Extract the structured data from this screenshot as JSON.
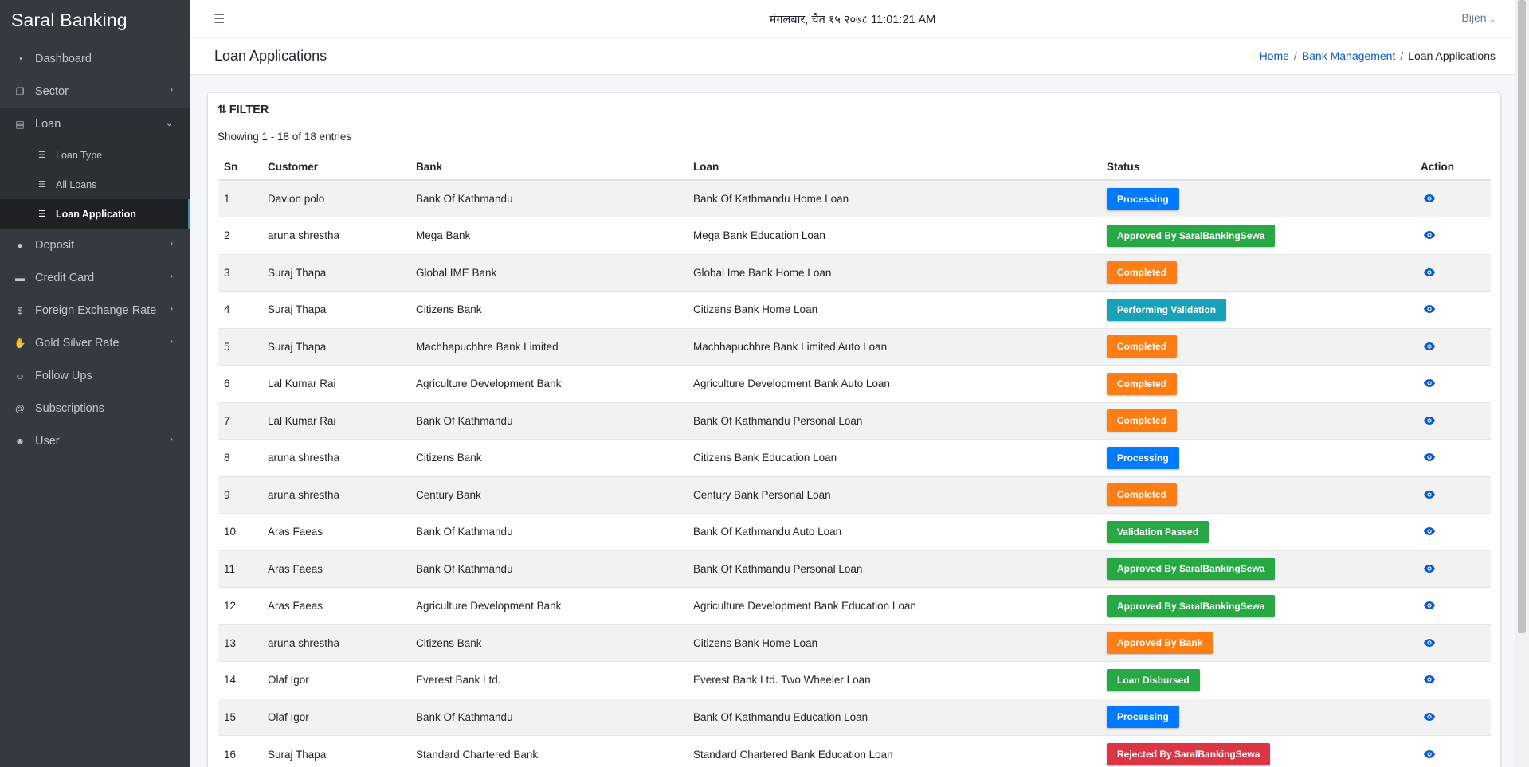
{
  "brand": "Saral Banking",
  "sidebar": {
    "items": [
      {
        "label": "Dashboard",
        "icon": "dashboard-icon",
        "glyph": "◔",
        "has_children": false
      },
      {
        "label": "Sector",
        "icon": "copy-icon",
        "glyph": "❐",
        "has_children": true
      },
      {
        "label": "Loan",
        "icon": "money-icon",
        "glyph": "▤",
        "has_children": true,
        "expanded": true,
        "children": [
          {
            "label": "Loan Type",
            "icon": "list-icon",
            "active": false
          },
          {
            "label": "All Loans",
            "icon": "list-icon",
            "active": false
          },
          {
            "label": "Loan Application",
            "icon": "list-icon",
            "active": true
          }
        ]
      },
      {
        "label": "Deposit",
        "icon": "piggy-bank-icon",
        "glyph": "●",
        "has_children": true
      },
      {
        "label": "Credit Card",
        "icon": "credit-card-icon",
        "glyph": "▬",
        "has_children": true
      },
      {
        "label": "Foreign Exchange Rate",
        "icon": "dollar-icon",
        "glyph": "$",
        "has_children": true
      },
      {
        "label": "Gold Silver Rate",
        "icon": "hand-coins-icon",
        "glyph": "✋",
        "has_children": true
      },
      {
        "label": "Follow Ups",
        "icon": "user-plus-icon",
        "glyph": "☺",
        "has_children": false
      },
      {
        "label": "Subscriptions",
        "icon": "at-icon",
        "glyph": "@",
        "has_children": false
      },
      {
        "label": "User",
        "icon": "users-icon",
        "glyph": "☻",
        "has_children": true
      }
    ]
  },
  "topbar": {
    "datetime": "मंगलबार, चैत १५ २०७८ 11:01:21 AM",
    "user": "Bijen"
  },
  "header": {
    "title": "Loan Applications",
    "breadcrumb": [
      "Home",
      "Bank Management",
      "Loan Applications"
    ]
  },
  "card": {
    "filter_label": "FILTER",
    "showing": "Showing 1 - 18 of 18 entries",
    "columns": [
      "Sn",
      "Customer",
      "Bank",
      "Loan",
      "Status",
      "Action"
    ],
    "rows": [
      {
        "sn": "1",
        "customer": "Davion polo",
        "bank": "Bank Of Kathmandu",
        "loan": "Bank Of Kathmandu Home Loan",
        "status": "Processing",
        "status_color": "#007bff"
      },
      {
        "sn": "2",
        "customer": "aruna shrestha",
        "bank": "Mega Bank",
        "loan": "Mega Bank Education Loan",
        "status": "Approved By SaralBankingSewa",
        "status_color": "#28a745"
      },
      {
        "sn": "3",
        "customer": "Suraj Thapa",
        "bank": "Global IME Bank",
        "loan": "Global Ime Bank Home Loan",
        "status": "Completed",
        "status_color": "#fd7e14"
      },
      {
        "sn": "4",
        "customer": "Suraj Thapa",
        "bank": "Citizens Bank",
        "loan": "Citizens Bank Home Loan",
        "status": "Performing Validation",
        "status_color": "#17a2b8"
      },
      {
        "sn": "5",
        "customer": "Suraj Thapa",
        "bank": "Machhapuchhre Bank Limited",
        "loan": "Machhapuchhre Bank Limited Auto Loan",
        "status": "Completed",
        "status_color": "#fd7e14"
      },
      {
        "sn": "6",
        "customer": "Lal Kumar Rai",
        "bank": "Agriculture Development Bank",
        "loan": "Agriculture Development Bank Auto Loan",
        "status": "Completed",
        "status_color": "#fd7e14"
      },
      {
        "sn": "7",
        "customer": "Lal Kumar Rai",
        "bank": "Bank Of Kathmandu",
        "loan": "Bank Of Kathmandu Personal Loan",
        "status": "Completed",
        "status_color": "#fd7e14"
      },
      {
        "sn": "8",
        "customer": "aruna shrestha",
        "bank": "Citizens Bank",
        "loan": "Citizens Bank Education Loan",
        "status": "Processing",
        "status_color": "#007bff"
      },
      {
        "sn": "9",
        "customer": "aruna shrestha",
        "bank": "Century Bank",
        "loan": "Century Bank Personal Loan",
        "status": "Completed",
        "status_color": "#fd7e14"
      },
      {
        "sn": "10",
        "customer": "Aras Faeas",
        "bank": "Bank Of Kathmandu",
        "loan": "Bank Of Kathmandu Auto Loan",
        "status": "Validation Passed",
        "status_color": "#28a745"
      },
      {
        "sn": "11",
        "customer": "Aras Faeas",
        "bank": "Bank Of Kathmandu",
        "loan": "Bank Of Kathmandu Personal Loan",
        "status": "Approved By SaralBankingSewa",
        "status_color": "#28a745"
      },
      {
        "sn": "12",
        "customer": "Aras Faeas",
        "bank": "Agriculture Development Bank",
        "loan": "Agriculture Development Bank Education Loan",
        "status": "Approved By SaralBankingSewa",
        "status_color": "#28a745"
      },
      {
        "sn": "13",
        "customer": "aruna shrestha",
        "bank": "Citizens Bank",
        "loan": "Citizens Bank Home Loan",
        "status": "Approved By Bank",
        "status_color": "#fd7e14"
      },
      {
        "sn": "14",
        "customer": "Olaf Igor",
        "bank": "Everest Bank Ltd.",
        "loan": "Everest Bank Ltd. Two Wheeler Loan",
        "status": "Loan Disbursed",
        "status_color": "#28a745"
      },
      {
        "sn": "15",
        "customer": "Olaf Igor",
        "bank": "Bank Of Kathmandu",
        "loan": "Bank Of Kathmandu Education Loan",
        "status": "Processing",
        "status_color": "#007bff"
      },
      {
        "sn": "16",
        "customer": "Suraj Thapa",
        "bank": "Standard Chartered Bank",
        "loan": "Standard Chartered Bank Education Loan",
        "status": "Rejected By SaralBankingSewa",
        "status_color": "#dc3545"
      }
    ]
  }
}
